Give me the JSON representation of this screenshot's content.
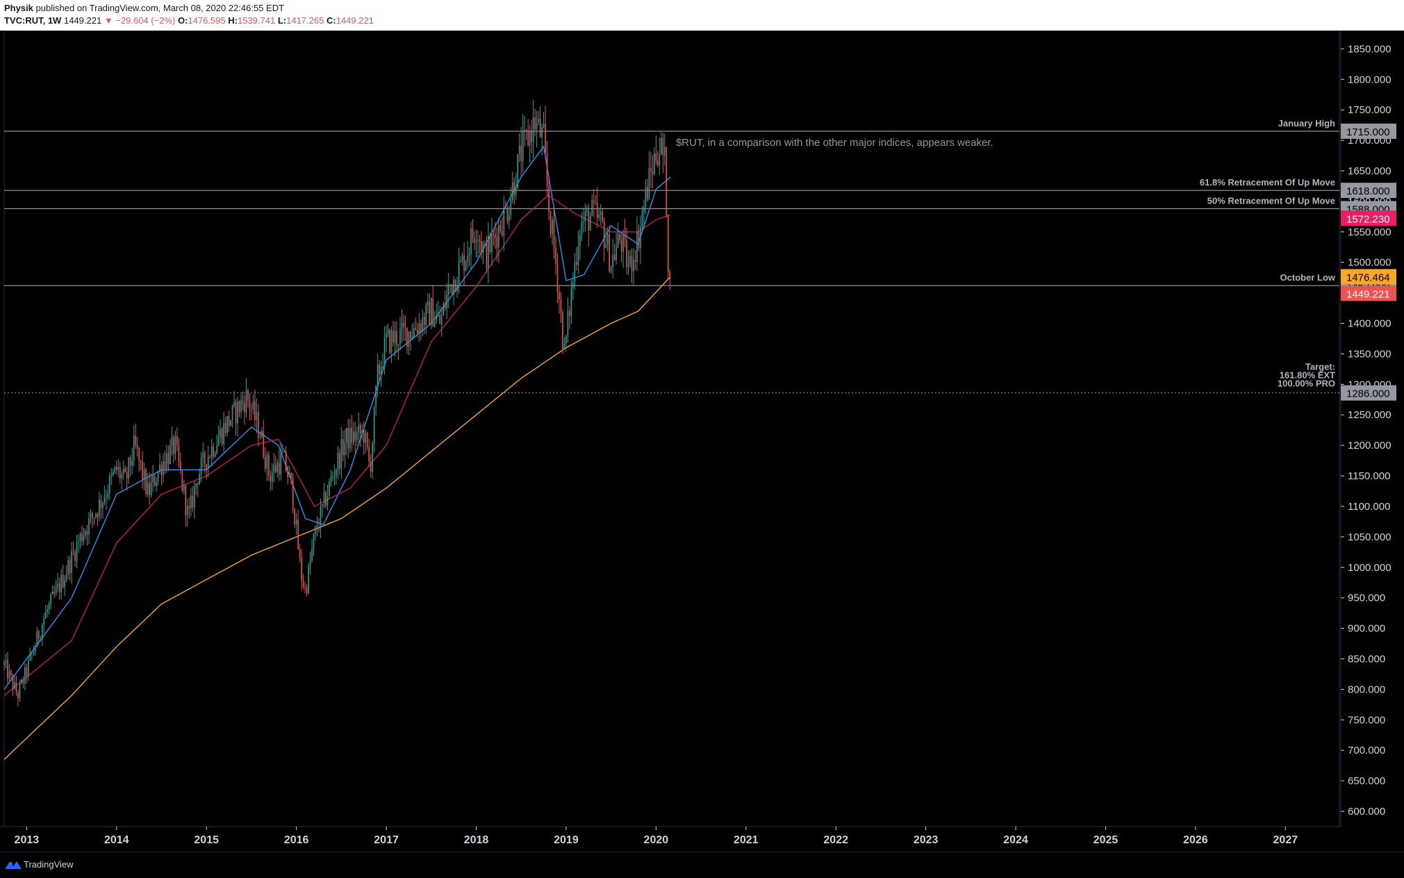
{
  "header": {
    "author": "Physik",
    "published": "published on TradingView.com, March 08, 2020 22:46:55 EDT",
    "symbol": "TVC:RUT, 1W",
    "last": "1449.221",
    "change": "▼ −29.604 (−2%)",
    "o_label": "O:",
    "o_val": "1476.595",
    "h_label": "H:",
    "h_val": "1539.741",
    "l_label": "L:",
    "l_val": "1417.265",
    "c_label": "C:",
    "c_val": "1449.221"
  },
  "footer": {
    "brand": "TradingView"
  },
  "colors": {
    "up": "#26a69a",
    "down": "#ef5350",
    "ema_fast": "#2196f3",
    "ema_mid": "#c2185b",
    "sma_long": "#f9a825"
  },
  "chart_data": {
    "type": "candlestick",
    "symbol": "TVC:RUT",
    "interval": "1W",
    "ylim": [
      575,
      1880
    ],
    "xlim": [
      2012.75,
      2027.6
    ],
    "x_ticks": [
      "2013",
      "2014",
      "2015",
      "2016",
      "2017",
      "2018",
      "2019",
      "2020",
      "2021",
      "2022",
      "2023",
      "2024",
      "2025",
      "2026",
      "2027"
    ],
    "y_ticks": [
      "600.000",
      "650.000",
      "700.000",
      "750.000",
      "800.000",
      "850.000",
      "900.000",
      "950.000",
      "1000.000",
      "1050.000",
      "1100.000",
      "1150.000",
      "1200.000",
      "1250.000",
      "1300.000",
      "1350.000",
      "1400.000",
      "1450.000",
      "1500.000",
      "1550.000",
      "1600.000",
      "1650.000",
      "1700.000",
      "1750.000",
      "1800.000",
      "1850.000"
    ],
    "price_path": [
      [
        2012.75,
        840
      ],
      [
        2012.9,
        790
      ],
      [
        2013.0,
        830
      ],
      [
        2013.2,
        920
      ],
      [
        2013.4,
        980
      ],
      [
        2013.6,
        1050
      ],
      [
        2013.8,
        1100
      ],
      [
        2014.0,
        1160
      ],
      [
        2014.1,
        1140
      ],
      [
        2014.2,
        1200
      ],
      [
        2014.35,
        1120
      ],
      [
        2014.5,
        1170
      ],
      [
        2014.65,
        1200
      ],
      [
        2014.8,
        1080
      ],
      [
        2014.9,
        1150
      ],
      [
        2015.0,
        1180
      ],
      [
        2015.2,
        1230
      ],
      [
        2015.45,
        1280
      ],
      [
        2015.6,
        1220
      ],
      [
        2015.7,
        1150
      ],
      [
        2015.85,
        1180
      ],
      [
        2015.95,
        1130
      ],
      [
        2016.05,
        990
      ],
      [
        2016.1,
        960
      ],
      [
        2016.2,
        1050
      ],
      [
        2016.4,
        1150
      ],
      [
        2016.55,
        1210
      ],
      [
        2016.75,
        1220
      ],
      [
        2016.82,
        1160
      ],
      [
        2016.9,
        1310
      ],
      [
        2017.0,
        1370
      ],
      [
        2017.3,
        1390
      ],
      [
        2017.5,
        1420
      ],
      [
        2017.6,
        1400
      ],
      [
        2017.7,
        1460
      ],
      [
        2017.85,
        1500
      ],
      [
        2018.0,
        1560
      ],
      [
        2018.1,
        1510
      ],
      [
        2018.2,
        1540
      ],
      [
        2018.35,
        1590
      ],
      [
        2018.5,
        1680
      ],
      [
        2018.65,
        1730
      ],
      [
        2018.75,
        1700
      ],
      [
        2018.8,
        1600
      ],
      [
        2018.9,
        1480
      ],
      [
        2018.98,
        1350
      ],
      [
        2019.05,
        1440
      ],
      [
        2019.15,
        1560
      ],
      [
        2019.3,
        1580
      ],
      [
        2019.4,
        1560
      ],
      [
        2019.5,
        1500
      ],
      [
        2019.6,
        1540
      ],
      [
        2019.7,
        1490
      ],
      [
        2019.8,
        1540
      ],
      [
        2019.9,
        1620
      ],
      [
        2020.0,
        1680
      ],
      [
        2020.05,
        1690
      ],
      [
        2020.1,
        1660
      ],
      [
        2020.12,
        1580
      ],
      [
        2020.14,
        1480
      ],
      [
        2020.16,
        1449.221
      ]
    ],
    "moving_averages": [
      {
        "kind": "ema_fast",
        "points": [
          [
            2012.75,
            800
          ],
          [
            2013.5,
            950
          ],
          [
            2014.0,
            1120
          ],
          [
            2014.5,
            1160
          ],
          [
            2015.0,
            1160
          ],
          [
            2015.5,
            1230
          ],
          [
            2015.8,
            1200
          ],
          [
            2016.1,
            1080
          ],
          [
            2016.3,
            1070
          ],
          [
            2016.6,
            1160
          ],
          [
            2017.0,
            1340
          ],
          [
            2017.5,
            1400
          ],
          [
            2018.0,
            1500
          ],
          [
            2018.5,
            1640
          ],
          [
            2018.75,
            1690
          ],
          [
            2019.0,
            1470
          ],
          [
            2019.2,
            1480
          ],
          [
            2019.5,
            1560
          ],
          [
            2019.8,
            1530
          ],
          [
            2020.0,
            1620
          ],
          [
            2020.16,
            1640
          ]
        ]
      },
      {
        "kind": "ema_mid",
        "points": [
          [
            2012.75,
            790
          ],
          [
            2013.5,
            880
          ],
          [
            2014.0,
            1040
          ],
          [
            2014.5,
            1120
          ],
          [
            2015.0,
            1150
          ],
          [
            2015.5,
            1200
          ],
          [
            2015.8,
            1210
          ],
          [
            2016.2,
            1100
          ],
          [
            2016.6,
            1130
          ],
          [
            2017.0,
            1200
          ],
          [
            2017.5,
            1370
          ],
          [
            2018.0,
            1460
          ],
          [
            2018.5,
            1570
          ],
          [
            2018.8,
            1610
          ],
          [
            2019.1,
            1580
          ],
          [
            2019.5,
            1550
          ],
          [
            2019.8,
            1550
          ],
          [
            2020.0,
            1570
          ],
          [
            2020.16,
            1578
          ]
        ]
      },
      {
        "kind": "sma_long",
        "points": [
          [
            2012.75,
            685
          ],
          [
            2013.5,
            790
          ],
          [
            2014.0,
            870
          ],
          [
            2014.5,
            940
          ],
          [
            2015.0,
            980
          ],
          [
            2015.5,
            1020
          ],
          [
            2016.0,
            1050
          ],
          [
            2016.5,
            1080
          ],
          [
            2017.0,
            1130
          ],
          [
            2017.5,
            1190
          ],
          [
            2018.0,
            1250
          ],
          [
            2018.5,
            1310
          ],
          [
            2019.0,
            1360
          ],
          [
            2019.5,
            1400
          ],
          [
            2019.8,
            1420
          ],
          [
            2020.16,
            1476.464
          ]
        ]
      }
    ],
    "horizontal_levels": [
      {
        "price": 1715.0,
        "label": "January High",
        "badge": "1715.000",
        "style": "solid"
      },
      {
        "price": 1618.0,
        "label": "61.8% Retracement Of Up Move",
        "badge": "1618.000",
        "style": "solid"
      },
      {
        "price": 1588.0,
        "label": "50% Retracement Of Up Move",
        "badge": "1588.000",
        "style": "solid"
      },
      {
        "price": 1462.0,
        "label": "October Low",
        "badge": "1462.000",
        "style": "solid"
      },
      {
        "price": 1286.0,
        "label": "Target:",
        "label2": "161.80% EXT",
        "label3": "100.00% PRO",
        "badge": "1286.000",
        "style": "dotted"
      }
    ],
    "price_badges": [
      {
        "price": 1572.23,
        "text": "1572.230",
        "kind": "ema_mid"
      },
      {
        "price": 1476.464,
        "text": "1476.464",
        "kind": "sma_long"
      },
      {
        "price": 1449.221,
        "text": "1449.221",
        "kind": "last"
      }
    ],
    "annotation": {
      "x": 2020.22,
      "price": 1691,
      "text": "$RUT, in a comparison with the other major indices, appears weaker."
    }
  }
}
